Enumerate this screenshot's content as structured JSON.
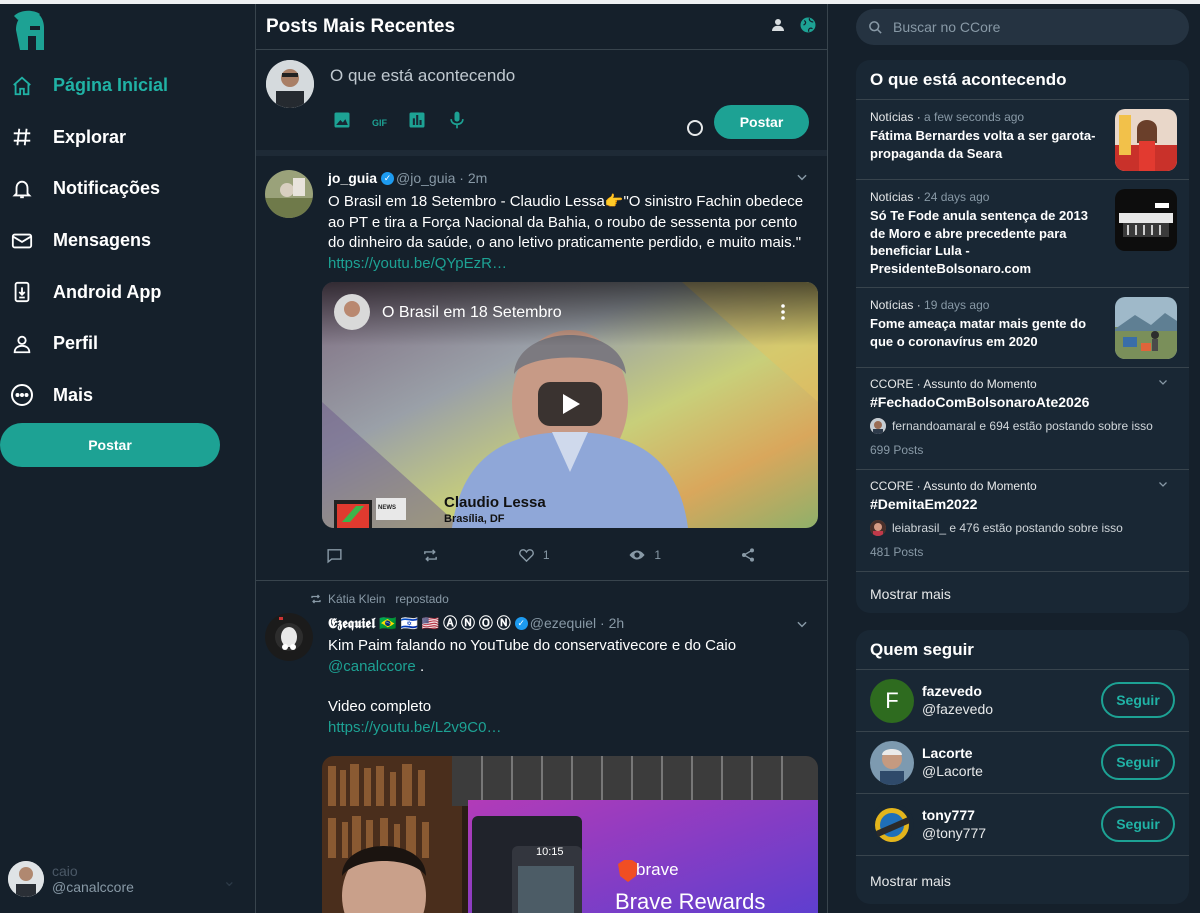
{
  "colors": {
    "accent": "#1da294",
    "background": "#15202b",
    "panel": "#192734",
    "link": "#1da294"
  },
  "sidebar": {
    "logo_icon": "spartan-helmet-icon",
    "items": [
      {
        "label": "Página Inicial",
        "icon": "home-icon",
        "active": true
      },
      {
        "label": "Explorar",
        "icon": "hashtag-icon"
      },
      {
        "label": "Notificações",
        "icon": "bell-icon"
      },
      {
        "label": "Mensagens",
        "icon": "mail-icon"
      },
      {
        "label": "Android App",
        "icon": "android-download-icon"
      },
      {
        "label": "Perfil",
        "icon": "person-icon"
      },
      {
        "label": "Mais",
        "icon": "more-circle-icon"
      }
    ],
    "post_label": "Postar",
    "account": {
      "name": "caio",
      "handle": "@canalccore"
    }
  },
  "center": {
    "title": "Posts Mais Recentes",
    "composer": {
      "placeholder": "O que está acontecendo",
      "post_label": "Postar",
      "gif_label": "GIF"
    },
    "tweets": [
      {
        "name": "jo_guia",
        "handle": "@jo_guia",
        "time": "2m",
        "text": "O Brasil em 18 Setembro - Claudio Lessa👉\"O sinistro Fachin obedece ao PT e tira a Força Nacional da Bahia, o roubo de sessenta por cento do dinheiro da saúde, o ano letivo praticamente perdido, e muito mais.\" ",
        "link": "https://youtu.be/QYpEzR…",
        "video_title": "O Brasil em 18 Setembro",
        "video_caption_name": "Claudio Lessa",
        "video_caption_place": "Brasília, DF",
        "video_logo_text": "NEWS",
        "likes": "1",
        "views": "1"
      },
      {
        "repost_by": "Kátia Klein",
        "repost_label": "repostado",
        "name": "𝕰𝖟𝖊𝖖𝖚𝖎𝖊𝖑 🇧🇷 🇮🇱 🇺🇸 Ⓐ Ⓝ Ⓞ Ⓝ",
        "handle": "@ezequiel",
        "time": "2h",
        "text_line1": "Kim Paim falando no YouTube do  conservativecore e do Caio",
        "mention": "@canalccore",
        "mention_suffix": " .",
        "text_line2": "Video completo",
        "link": "https://youtu.be/L2v9C0…",
        "video_clock": "10:15",
        "video_brand": "brave",
        "video_brand_title": "Brave Rewards"
      }
    ]
  },
  "right": {
    "search_placeholder": "Buscar no CCore",
    "whats_happening": {
      "title": "O que está acontecendo",
      "news": [
        {
          "source": "Notícias",
          "age": "a few seconds ago",
          "title": "Fátima Bernardes volta a ser garota-propaganda da Seara"
        },
        {
          "source": "Notícias",
          "age": "24 days ago",
          "title": "Só Te Fode anula sentença de 2013 de Moro e abre precedente para beneficiar Lula - PresidenteBolsonaro.com"
        },
        {
          "source": "Notícias",
          "age": "19 days ago",
          "title": "Fome ameaça matar mais gente do que o coronavírus em 2020"
        }
      ],
      "trends": [
        {
          "meta": "CCORE · Assunto do Momento",
          "tag": "#FechadoComBolsonaroAte2026",
          "who": "fernandoamaral e 694 estão postando sobre isso",
          "count": "699 Posts"
        },
        {
          "meta": "CCORE · Assunto do Momento",
          "tag": "#DemitaEm2022",
          "who": "leiabrasil_ e 476 estão postando sobre isso",
          "count": "481 Posts"
        }
      ],
      "show_more": "Mostrar mais"
    },
    "who_to_follow": {
      "title": "Quem seguir",
      "users": [
        {
          "name": "fazevedo",
          "handle": "@fazevedo",
          "initial": "F",
          "button": "Seguir"
        },
        {
          "name": "Lacorte",
          "handle": "@Lacorte",
          "button": "Seguir"
        },
        {
          "name": "tony777",
          "handle": "@tony777",
          "button": "Seguir"
        }
      ],
      "show_more": "Mostrar mais"
    }
  }
}
